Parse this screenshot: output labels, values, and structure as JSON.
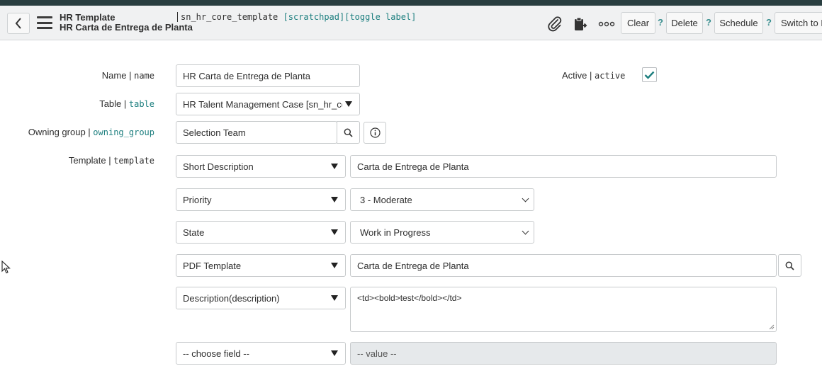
{
  "header": {
    "record_type": "HR Template",
    "record_name": "HR Carta de Entrega de Planta",
    "table_name": "sn_hr_core_template",
    "scratchpad": "[scratchpad]",
    "toggle_label": "[toggle label]",
    "buttons": {
      "clear": "Clear",
      "delete": "Delete",
      "schedule": "Schedule",
      "switch": "Switch to Multi-Value"
    },
    "help": "?"
  },
  "form": {
    "name": {
      "label": "Name",
      "field": "name",
      "value": "HR Carta de  Entrega de Planta"
    },
    "table": {
      "label": "Table",
      "field": "table",
      "value": "HR Talent Management Case [sn_hr_co..."
    },
    "owning_group": {
      "label": "Owning group",
      "field": "owning_group",
      "value": "Selection Team"
    },
    "active": {
      "label": "Active",
      "field": "active",
      "checked": true
    },
    "template": {
      "label": "Template",
      "field": "template",
      "rows": [
        {
          "field": "Short Description",
          "value": "Carta de  Entrega de Planta"
        },
        {
          "field": "Priority",
          "value": "3 - Moderate"
        },
        {
          "field": "State",
          "value": "Work in Progress"
        },
        {
          "field": "PDF Template",
          "value": "Carta de  Entrega de Planta"
        },
        {
          "field": "Description(description)",
          "value": "<td><bold>test</bold></td>"
        },
        {
          "field": "-- choose field --",
          "value": "-- value --"
        }
      ]
    }
  },
  "colors": {
    "accent": "#1d7f7f",
    "topbar": "#293e40",
    "header_bg": "#f0f1f2"
  }
}
